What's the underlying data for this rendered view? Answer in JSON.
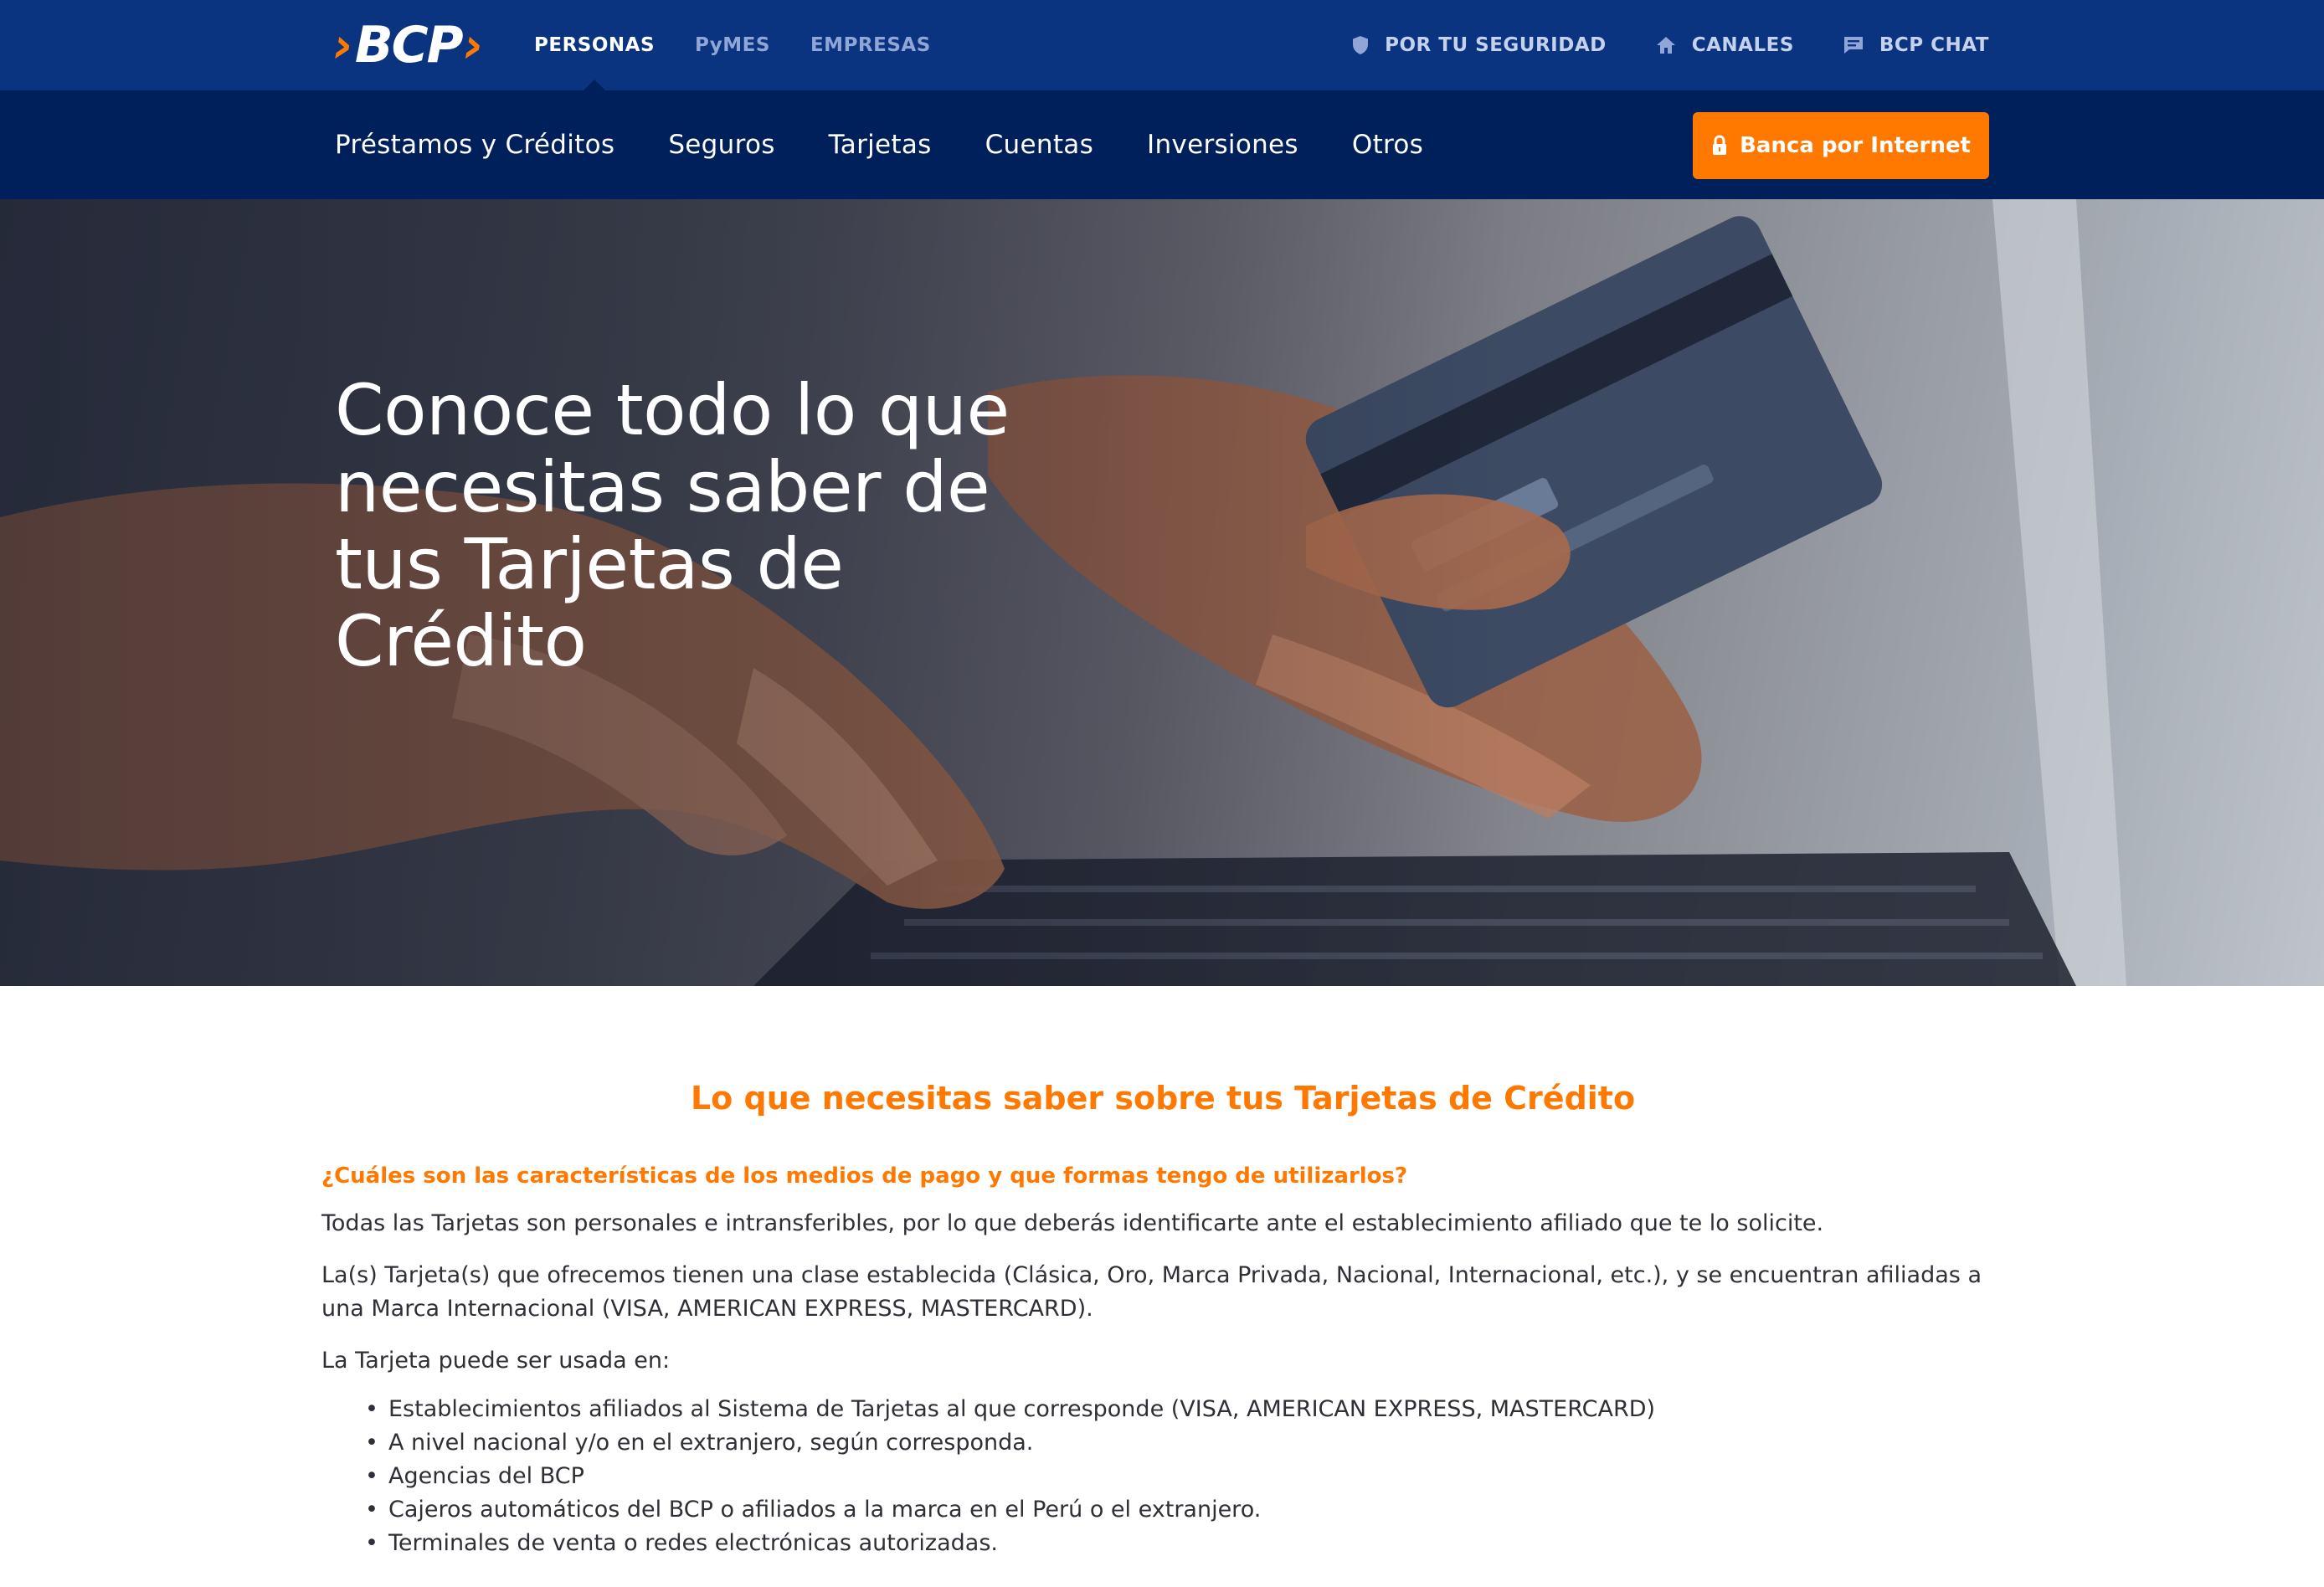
{
  "topbar": {
    "logo_text": "BCP",
    "segments": [
      "PERSONAS",
      "PyMES",
      "EMPRESAS"
    ],
    "active_segment": "PERSONAS",
    "utility": [
      {
        "label": "POR TU SEGURIDAD",
        "icon": "shield-icon"
      },
      {
        "label": "CANALES",
        "icon": "home-icon"
      },
      {
        "label": "BCP CHAT",
        "icon": "chat-icon"
      }
    ]
  },
  "mainnav": {
    "links": [
      "Préstamos y Créditos",
      "Seguros",
      "Tarjetas",
      "Cuentas",
      "Inversiones",
      "Otros"
    ],
    "cta_label": "Banca por Internet",
    "cta_icon": "lock-icon"
  },
  "hero": {
    "title": "Conoce todo lo que necesitas saber de tus Tarjetas de Crédito"
  },
  "content": {
    "section_title": "Lo que necesitas saber sobre tus Tarjetas de Crédito",
    "question": "¿Cuáles son las características de los medios de pago y que formas tengo de utilizarlos?",
    "paragraphs": [
      "Todas las Tarjetas son personales e intransferibles, por lo que deberás identificarte ante el establecimiento afiliado que te lo solicite.",
      "La(s) Tarjeta(s) que ofrecemos tienen una clase establecida (Clásica, Oro, Marca Privada, Nacional, Internacional, etc.), y se encuentran afiliadas a una Marca Internacional (VISA, AMERICAN EXPRESS, MASTERCARD).",
      "La Tarjeta puede ser usada en:"
    ],
    "bullets": [
      "Establecimientos afiliados al Sistema de Tarjetas al que corresponde (VISA, AMERICAN EXPRESS, MASTERCARD)",
      "A nivel nacional y/o en el extranjero, según corresponda.",
      "Agencias del BCP",
      "Cajeros automáticos del BCP o afiliados a la marca en el Perú o el extranjero.",
      "Terminales de venta o redes electrónicas autorizadas."
    ]
  },
  "colors": {
    "topbar": "#0a3380",
    "mainnav": "#00205c",
    "accent": "#ff7800"
  }
}
